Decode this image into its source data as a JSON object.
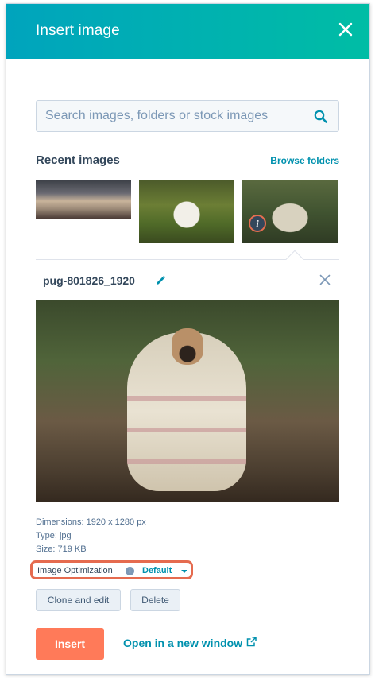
{
  "header": {
    "title": "Insert image"
  },
  "search": {
    "placeholder": "Search images, folders or stock images"
  },
  "recent": {
    "title": "Recent images",
    "browse_label": "Browse folders"
  },
  "detail": {
    "file_name": "pug-801826_1920",
    "dimensions": "Dimensions: 1920 x 1280 px",
    "type": "Type: jpg",
    "size": "Size: 719 KB",
    "optimization_label": "Image Optimization",
    "optimization_value": "Default",
    "clone_label": "Clone and edit",
    "delete_label": "Delete"
  },
  "footer": {
    "insert_label": "Insert",
    "open_label": "Open in a new window"
  },
  "colors": {
    "header_gradient_start": "#00a4bd",
    "header_gradient_end": "#00bda5",
    "primary_button": "#ff7a59",
    "link": "#0091ae",
    "highlight": "#e56b4f"
  },
  "icons": [
    "close-icon",
    "search-icon",
    "info-icon",
    "pencil-icon",
    "external-link-icon",
    "chevron-down-icon"
  ]
}
